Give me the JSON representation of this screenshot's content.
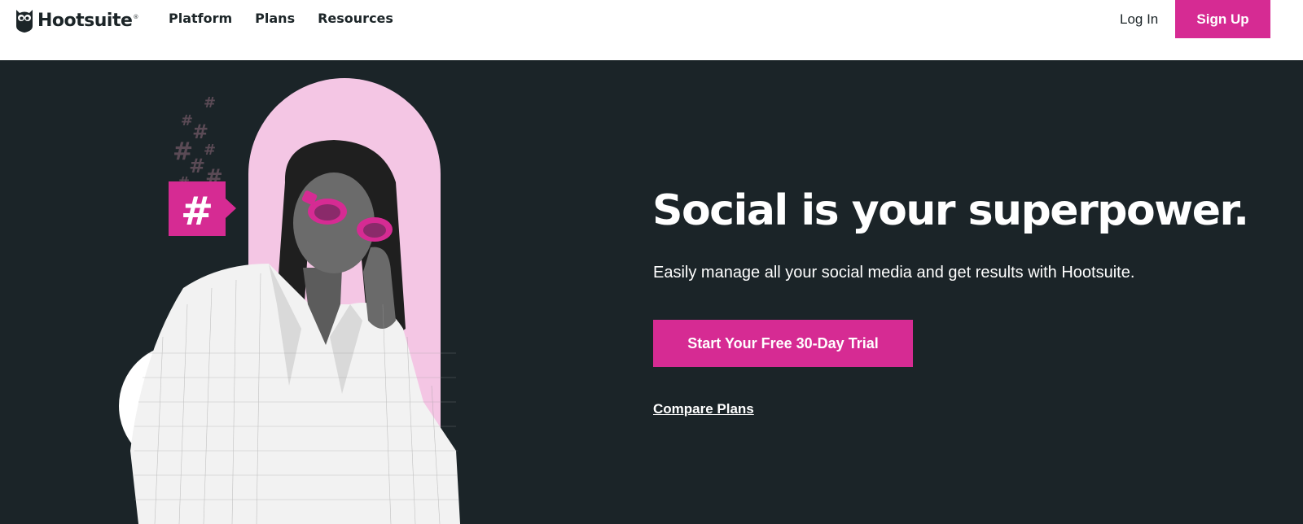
{
  "header": {
    "brand": "Hootsuite",
    "nav": [
      "Platform",
      "Plans",
      "Resources"
    ],
    "login_label": "Log In",
    "signup_label": "Sign Up"
  },
  "hero": {
    "headline": "Social is your superpower.",
    "subhead": "Easily manage all your social media and get results with Hootsuite.",
    "cta_label": "Start Your Free 30-Day Trial",
    "compare_label": "Compare Plans",
    "hashtag_symbol": "#"
  },
  "colors": {
    "accent": "#d62b93",
    "hero_bg": "#1b2428",
    "pink_arch": "#f4c6e4"
  }
}
